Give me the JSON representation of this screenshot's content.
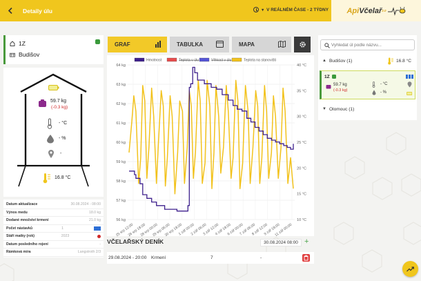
{
  "header": {
    "title": "Detaily úlu",
    "time_label": "V REÁLNÉM ČASE - 2 TÝDNY",
    "logo_part1": "Api",
    "logo_part2": "Včelař",
    "logo_version": "2.0",
    "colors": {
      "bar": "#f0c61d"
    }
  },
  "hive": {
    "name": "1Z",
    "location": "Budišov",
    "weight": "59.7 kg",
    "weight_change": "(-0.3 kg)",
    "inner_temp": "- °C",
    "humidity": "- %",
    "gps": "-",
    "outside_temp": "16.8 °C"
  },
  "info": [
    {
      "label": "Datum aktualizace",
      "value": "30.08.2024 - 08:00"
    },
    {
      "label": "Výnos medu",
      "value": "18.0 kg"
    },
    {
      "label": "Dodané množství krmení",
      "value": "21.0 kg"
    },
    {
      "label": "Počet nástavků",
      "value": "1"
    },
    {
      "label": "Stáří matky (rok)",
      "value": "2023"
    },
    {
      "label": "Datum posledního rojení",
      "value": "-"
    },
    {
      "label": "Rámková míra",
      "value": "Langstroth 2/3"
    }
  ],
  "tabs": [
    {
      "label": "GRAF",
      "icon": "bar-chart-icon"
    },
    {
      "label": "TABULKA",
      "icon": "table-icon"
    },
    {
      "label": "MAPA",
      "icon": "map-icon"
    }
  ],
  "chart_data": {
    "type": "line",
    "legend": [
      "Hmotnost",
      "Teplota v úlu",
      "Vlhkost v úlu",
      "Teplota na stanovišti"
    ],
    "colors": [
      "#3d1f8c",
      "#e74c4c",
      "#5555d6",
      "#f2c21c"
    ],
    "y_left_ticks": [
      "64 kg",
      "63 kg",
      "62 kg",
      "61 kg",
      "60 kg",
      "59 kg",
      "58 kg",
      "57 kg",
      "56 kg"
    ],
    "y_right_ticks": [
      "40 °C",
      "35 °C",
      "30 °C",
      "25 °C",
      "20 °C",
      "15 °C",
      "10 °C"
    ],
    "x_ticks": [
      "25 srp 12:00",
      "26 srp 18:00",
      "28 srp 00:00",
      "29 srp 06:00",
      "30 srp 18:00",
      "1 zář 00:00",
      "2 zář 06:00",
      "3 zář 12:00",
      "4 zář 18:00",
      "6 zář 00:00",
      "7 zář 06:00",
      "8 zář 12:00",
      "9 zář 18:00",
      "11 zář 00:00"
    ],
    "ylim_left": [
      55.5,
      64
    ],
    "ylim_right": [
      10,
      40
    ],
    "weight_series": [
      [
        0,
        57.9
      ],
      [
        8,
        57.7
      ],
      [
        10,
        57.5
      ],
      [
        16,
        57.2
      ],
      [
        20,
        56.6
      ],
      [
        26,
        56.4
      ],
      [
        33,
        56.2
      ],
      [
        40,
        56.0
      ],
      [
        52,
        55.8
      ],
      [
        70,
        55.7
      ],
      [
        82,
        55.7
      ],
      [
        86,
        56.0
      ],
      [
        88,
        62.5
      ],
      [
        90,
        62.7
      ],
      [
        93,
        63.6
      ],
      [
        96,
        63.3
      ],
      [
        100,
        62.9
      ],
      [
        110,
        62.7
      ],
      [
        120,
        62.5
      ],
      [
        128,
        62.4
      ],
      [
        136,
        62.1
      ],
      [
        145,
        61.8
      ],
      [
        152,
        61.5
      ],
      [
        158,
        61.3
      ],
      [
        165,
        61.2
      ],
      [
        172,
        60.8
      ],
      [
        178,
        60.6
      ],
      [
        184,
        60.3
      ],
      [
        190,
        60.1
      ],
      [
        196,
        59.9
      ],
      [
        202,
        59.7
      ],
      [
        208,
        59.6
      ],
      [
        214,
        59.5
      ],
      [
        220,
        59.4
      ],
      [
        226,
        59.3
      ],
      [
        231,
        59.2
      ],
      [
        236,
        59.1
      ],
      [
        240,
        59.4
      ]
    ],
    "temp_series": [
      [
        0,
        23
      ],
      [
        4,
        29
      ],
      [
        7,
        34
      ],
      [
        10,
        31
      ],
      [
        14,
        17
      ],
      [
        17,
        22
      ],
      [
        20,
        36
      ],
      [
        23,
        33
      ],
      [
        26,
        18
      ],
      [
        29,
        24
      ],
      [
        33,
        35.5
      ],
      [
        36,
        30
      ],
      [
        40,
        17
      ],
      [
        43,
        25
      ],
      [
        47,
        35
      ],
      [
        50,
        32
      ],
      [
        53,
        16.5
      ],
      [
        56,
        22
      ],
      [
        60,
        34
      ],
      [
        63,
        30
      ],
      [
        67,
        15
      ],
      [
        71,
        23
      ],
      [
        74,
        33
      ],
      [
        78,
        31
      ],
      [
        81,
        17
      ],
      [
        85,
        24
      ],
      [
        88,
        35
      ],
      [
        91,
        32
      ],
      [
        94,
        18
      ],
      [
        97,
        23
      ],
      [
        101,
        37
      ],
      [
        104,
        33
      ],
      [
        107,
        17
      ],
      [
        111,
        21
      ],
      [
        114,
        37
      ],
      [
        118,
        32
      ],
      [
        121,
        16
      ],
      [
        124,
        23
      ],
      [
        127,
        36
      ],
      [
        131,
        30
      ],
      [
        134,
        19
      ],
      [
        138,
        24
      ],
      [
        142,
        36
      ],
      [
        145,
        31
      ],
      [
        149,
        18
      ],
      [
        152,
        22
      ],
      [
        156,
        37
      ],
      [
        159,
        33
      ],
      [
        162,
        16
      ],
      [
        166,
        21
      ],
      [
        170,
        36
      ],
      [
        174,
        31
      ],
      [
        177,
        17
      ],
      [
        181,
        24
      ],
      [
        185,
        35
      ],
      [
        188,
        32
      ],
      [
        191,
        17
      ],
      [
        194,
        22
      ],
      [
        198,
        36
      ],
      [
        201,
        31
      ],
      [
        204,
        18
      ],
      [
        208,
        23
      ],
      [
        211,
        34
      ],
      [
        214,
        30
      ],
      [
        218,
        18
      ],
      [
        222,
        24
      ],
      [
        225,
        35.5
      ],
      [
        228,
        31
      ],
      [
        232,
        17
      ],
      [
        236,
        22
      ],
      [
        240,
        16
      ]
    ]
  },
  "diary": {
    "title": "VČELAŘSKÝ DENÍK",
    "date": "30.08.2024 08:00",
    "row": {
      "datetime": "29.08.2024 - 20:00",
      "type": "Krmení",
      "amount": "7",
      "note": "-"
    }
  },
  "right": {
    "search_placeholder": "Vyhledat úl podle názvu...",
    "group1": {
      "name": "Budišov (1)",
      "temp": "16.8 °C"
    },
    "card": {
      "name": "1Z",
      "weight": "59.7 kg",
      "change": "(-0.3 kg)",
      "temp": "- °C",
      "hum": "- %"
    },
    "group2": {
      "name": "Olomouc (1)"
    }
  }
}
